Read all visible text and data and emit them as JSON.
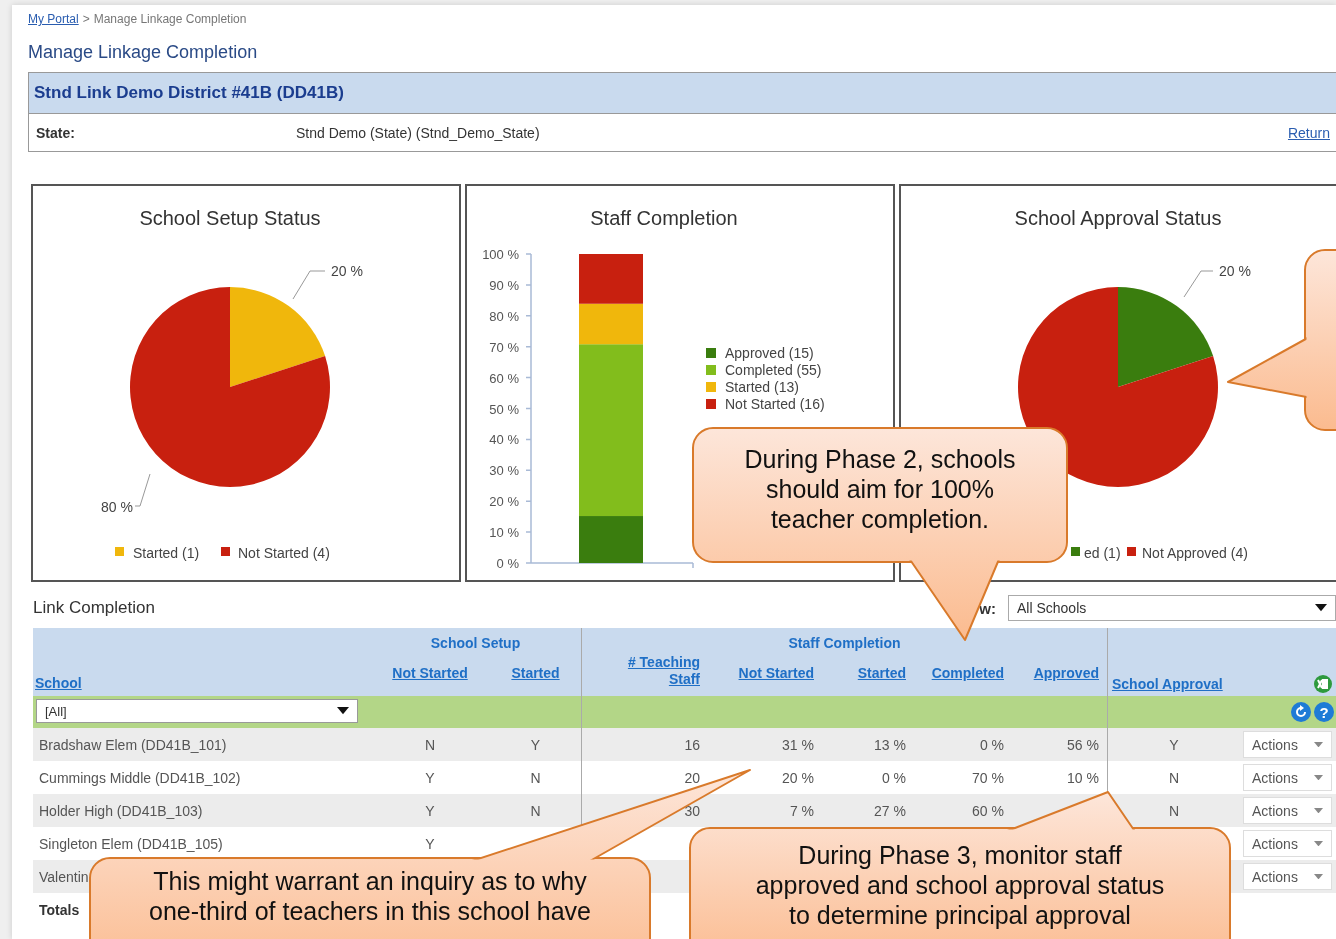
{
  "breadcrumb": {
    "link": "My Portal",
    "separator": ">",
    "current": "Manage Linkage Completion"
  },
  "page_title": "Manage Linkage Completion",
  "district": {
    "name": "Stnd Link Demo District #41B (DD41B)",
    "state_label": "State:",
    "state_value": "Stnd Demo (State) (Stnd_Demo_State)",
    "return_link": "Return"
  },
  "charts": [
    {
      "chart_data": {
        "type": "pie",
        "title": "School Setup Status",
        "categories": [
          "Started (1)",
          "Not Started (4)"
        ],
        "values": [
          20,
          80
        ],
        "colors": [
          "#f0b70c",
          "#c8200f"
        ],
        "value_labels": [
          "20 %",
          "80 %"
        ],
        "legend": true
      }
    },
    {
      "chart_data": {
        "type": "bar",
        "title": "Staff Completion",
        "stacked": true,
        "legend": true,
        "ylim": [
          0,
          100
        ],
        "yticks": [
          {
            "value": 0,
            "label": "0 %"
          },
          {
            "value": 10,
            "label": "10 %"
          },
          {
            "value": 20,
            "label": "20 %"
          },
          {
            "value": 30,
            "label": "30 %"
          },
          {
            "value": 40,
            "label": "40 %"
          },
          {
            "value": 50,
            "label": "50 %"
          },
          {
            "value": 60,
            "label": "60 %"
          },
          {
            "value": 70,
            "label": "70 %"
          },
          {
            "value": 80,
            "label": "80 %"
          },
          {
            "value": 90,
            "label": "90 %"
          },
          {
            "value": 100,
            "label": "100 %"
          }
        ],
        "series": [
          {
            "name": "Approved (15)",
            "color": "#3a7d0e",
            "values": [
              15.2
            ]
          },
          {
            "name": "Completed (55)",
            "color": "#82bd1c",
            "values": [
              55.6
            ]
          },
          {
            "name": "Started (13)",
            "color": "#f0b70c",
            "values": [
              13.1
            ]
          },
          {
            "name": "Not Started (16)",
            "color": "#c8200f",
            "values": [
              16.1
            ]
          }
        ]
      }
    },
    {
      "chart_data": {
        "type": "pie",
        "title": "School Approval Status",
        "categories": [
          "ed (1)",
          "Not Approved (4)"
        ],
        "values": [
          20,
          80
        ],
        "colors": [
          "#3a7d0e",
          "#c8200f"
        ],
        "value_labels": [
          "20 %",
          null
        ],
        "legend": true
      }
    }
  ],
  "link_completion": {
    "title": "Link Completion",
    "show_label": "w:",
    "show_select": "All Schools",
    "group_headers": [
      "School Setup",
      "Staff Completion"
    ],
    "columns": [
      "School",
      "Not Started",
      "Started",
      "# Teaching Staff",
      "Not Started",
      "Started",
      "Completed",
      "Approved",
      "School Approval"
    ],
    "school_filter": "[All]",
    "help_glyph": "?",
    "rows": [
      {
        "school": "Bradshaw Elem (DD41B_101)",
        "setup_not_started": "N",
        "setup_started": "Y",
        "teaching_staff": "16",
        "staff_not_started": "31 %",
        "staff_started": "13 %",
        "staff_completed": "0 %",
        "staff_approved": "56 %",
        "school_approval": "Y",
        "action": "Actions"
      },
      {
        "school": "Cummings Middle (DD41B_102)",
        "setup_not_started": "Y",
        "setup_started": "N",
        "teaching_staff": "20",
        "staff_not_started": "20 %",
        "staff_started": "0 %",
        "staff_completed": "70 %",
        "staff_approved": "10 %",
        "school_approval": "N",
        "action": "Actions"
      },
      {
        "school": "Holder High (DD41B_103)",
        "setup_not_started": "Y",
        "setup_started": "N",
        "teaching_staff": "30",
        "staff_not_started": "7 %",
        "staff_started": "27 %",
        "staff_completed": "60 %",
        "school_approval": "N",
        "action": "Actions"
      },
      {
        "school": "Singleton Elem (DD41B_105)",
        "setup_not_started": "Y",
        "action": "Actions"
      },
      {
        "school": "Valentin",
        "action": "Actions"
      }
    ],
    "totals": {
      "school": "Totals"
    }
  },
  "callouts": [
    {
      "kind": "callout",
      "lines": [
        "During Phase 2, schools",
        "should aim for 100%",
        "teacher completion."
      ]
    },
    {
      "kind": "callout",
      "lines": [
        "This might warrant an inquiry as to why",
        "one-third of teachers in this school have"
      ]
    },
    {
      "kind": "callout",
      "lines": [
        "During Phase 3, monitor staff",
        "approved and school approval status",
        "to determine principal approval"
      ]
    },
    {
      "kind": "callout"
    }
  ]
}
